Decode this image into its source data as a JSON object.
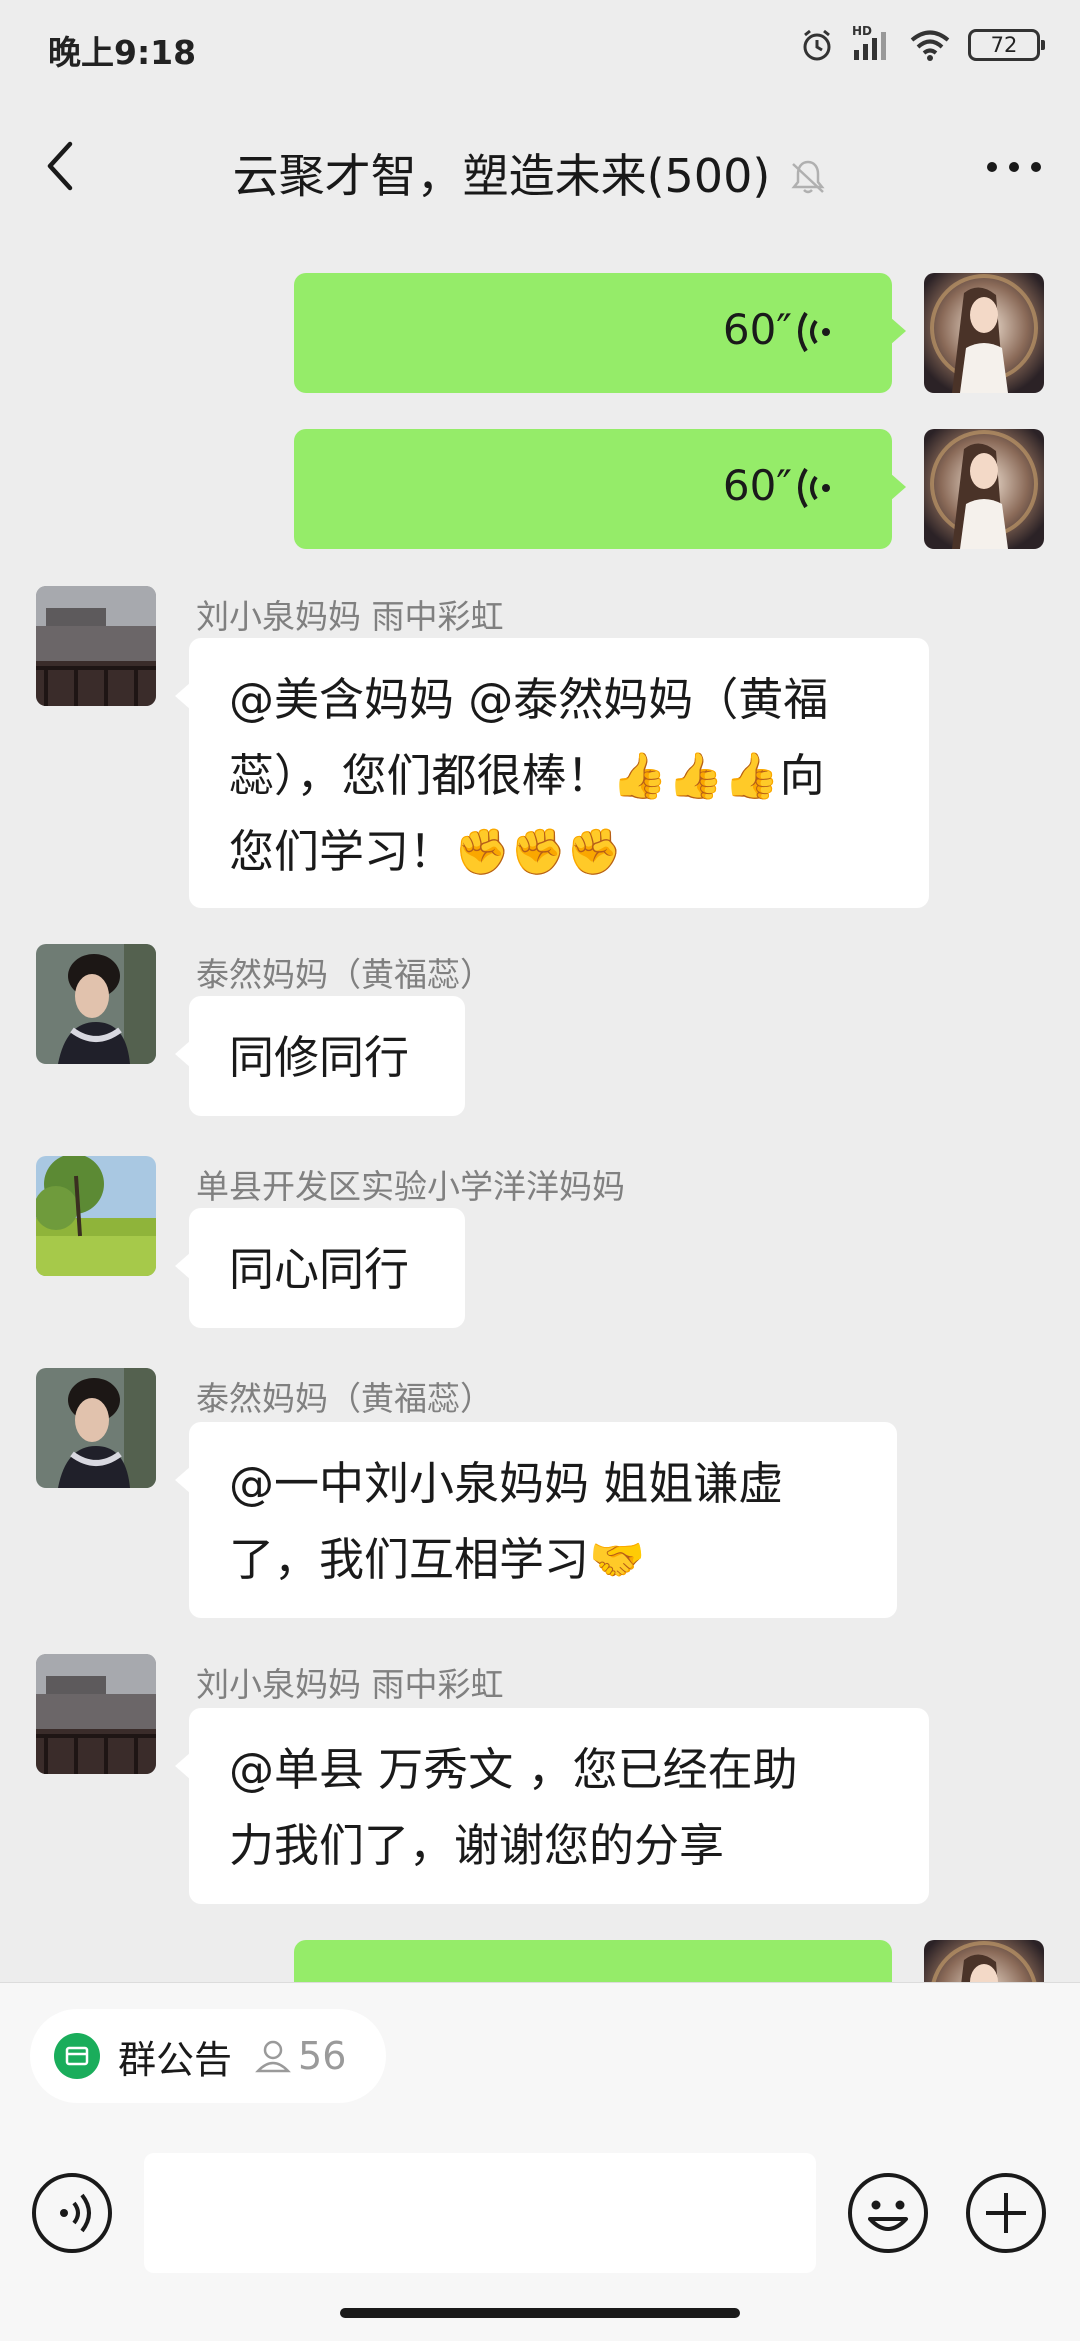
{
  "status_bar": {
    "time": "晚上9:18",
    "battery": "72",
    "network": "HD"
  },
  "header": {
    "title": "云聚才智，塑造未来(500)"
  },
  "messages": [
    {
      "type": "voice",
      "duration": "60″"
    },
    {
      "type": "voice",
      "duration": "60″"
    },
    {
      "type": "text",
      "sender": "刘小泉妈妈  雨中彩虹",
      "lines": [
        "@美含妈妈  @泰然妈妈（黄福",
        "蕊），您们都很棒！👍👍👍向",
        "您们学习！✊✊✊"
      ]
    },
    {
      "type": "text",
      "sender": "泰然妈妈（黄福蕊）",
      "lines": [
        "同修同行"
      ]
    },
    {
      "type": "text",
      "sender": "单县开发区实验小学洋洋妈妈",
      "lines": [
        "同心同行"
      ]
    },
    {
      "type": "text",
      "sender": "泰然妈妈（黄福蕊）",
      "lines": [
        "@一中刘小泉妈妈  姐姐谦虚",
        "了，我们互相学习🤝"
      ]
    },
    {
      "type": "text",
      "sender": "刘小泉妈妈  雨中彩虹",
      "lines": [
        "@单县    万秀文 ，您已经在助",
        "力我们了，谢谢您的分享"
      ]
    }
  ],
  "bottom": {
    "notice_label": "群公告",
    "member_count": "56",
    "input_value": ""
  },
  "colors": {
    "voice_bubble": "#95ec69",
    "chat_bg": "#ededed",
    "notice_icon": "#1aad5b"
  }
}
